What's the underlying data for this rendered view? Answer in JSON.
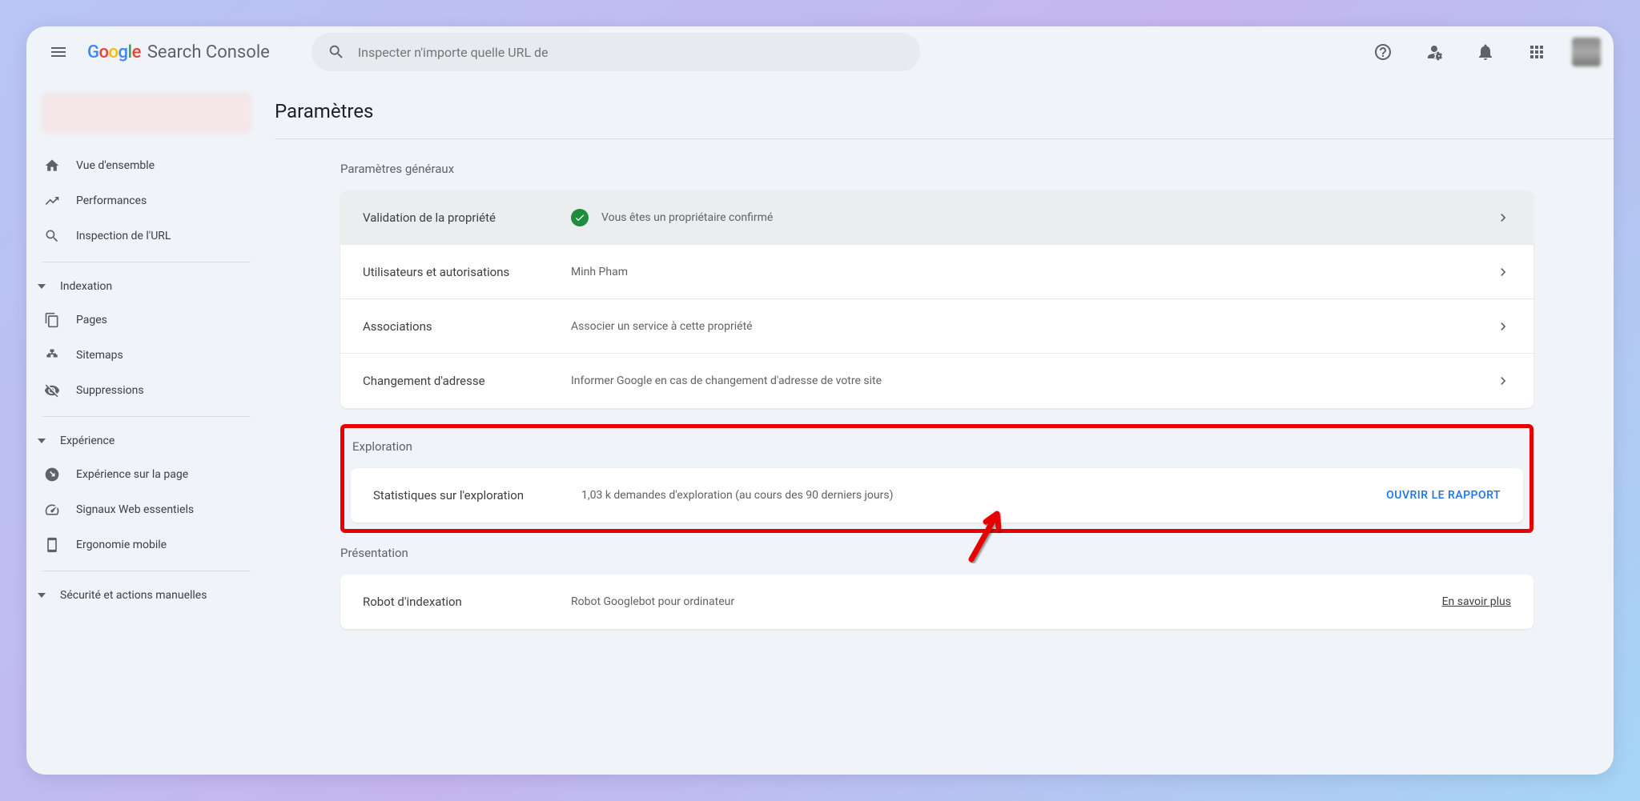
{
  "header": {
    "logo_product": "Search Console",
    "search_placeholder": "Inspecter n'importe quelle URL de"
  },
  "sidebar": {
    "items_top": [
      {
        "label": "Vue d'ensemble"
      },
      {
        "label": "Performances"
      },
      {
        "label": "Inspection de l'URL"
      }
    ],
    "section_indexation": "Indexation",
    "items_indexation": [
      {
        "label": "Pages"
      },
      {
        "label": "Sitemaps"
      },
      {
        "label": "Suppressions"
      }
    ],
    "section_experience": "Expérience",
    "items_experience": [
      {
        "label": "Expérience sur la page"
      },
      {
        "label": "Signaux Web essentiels"
      },
      {
        "label": "Ergonomie mobile"
      }
    ],
    "section_security": "Sécurité et actions manuelles"
  },
  "page": {
    "title": "Paramètres",
    "general": {
      "title": "Paramètres généraux",
      "rows": [
        {
          "label": "Validation de la propriété",
          "value": "Vous êtes un propriétaire confirmé",
          "verified": true
        },
        {
          "label": "Utilisateurs et autorisations",
          "value": "Minh Pham"
        },
        {
          "label": "Associations",
          "value": "Associer un service à cette propriété"
        },
        {
          "label": "Changement d'adresse",
          "value": "Informer Google en cas de changement d'adresse de votre site"
        }
      ]
    },
    "exploration": {
      "title": "Exploration",
      "row": {
        "label": "Statistiques sur l'exploration",
        "value": "1,03 k demandes d'exploration (au cours des 90 derniers jours)",
        "action": "OUVRIR LE RAPPORT"
      }
    },
    "presentation": {
      "title": "Présentation",
      "row": {
        "label": "Robot d'indexation",
        "value": "Robot Googlebot pour ordinateur",
        "link": "En savoir plus"
      }
    }
  }
}
